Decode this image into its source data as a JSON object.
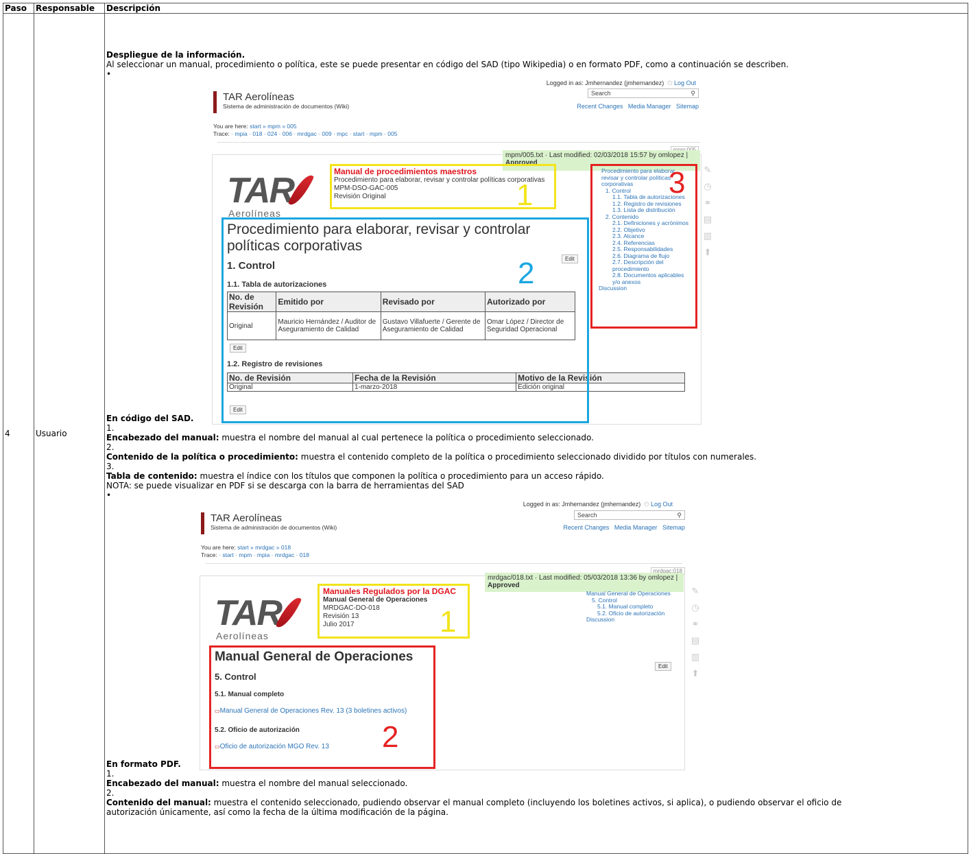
{
  "table": {
    "headers": {
      "paso": "Paso",
      "responsable": "Responsable",
      "descripcion": "Descripción"
    },
    "row": {
      "paso": "4",
      "responsable": "Usuario"
    }
  },
  "desc": {
    "title": "Despliegue de la información.",
    "intro": "Al seleccionar un manual, procedimiento o política, este se puede presentar en código del SAD (tipo Wikipedia) o en formato PDF, como a continuación se describen.",
    "bullet": "•",
    "sec1_caption": "En código del SAD.",
    "sec1_items": [
      {
        "n": "1.",
        "label": "Encabezado del manual:",
        "text": " muestra el nombre del manual al cual pertenece la política o procedimiento seleccionado."
      },
      {
        "n": "2.",
        "label": "Contenido de la política o procedimiento:",
        "text": " muestra el contenido completo de la política o procedimiento seleccionado dividido por títulos con numerales."
      },
      {
        "n": "3.",
        "label": "Tabla de contenido:",
        "text": " muestra el índice con los títulos que componen la política o procedimiento para un acceso rápido."
      }
    ],
    "note": "NOTA: se puede visualizar en PDF si se descarga con la barra de herramientas del SAD",
    "sec2_caption": "En formato PDF.",
    "sec2_items": [
      {
        "n": "1.",
        "label": "Encabezado del manual:",
        "text": " muestra el nombre del manual seleccionado."
      },
      {
        "n": "2.",
        "label": "Contenido del manual:",
        "text": " muestra el contenido seleccionado, pudiendo observar el manual completo (incluyendo los boletines activos, si aplica), o pudiendo observar el oficio de"
      }
    ],
    "last_line": "autorización únicamente, así como la fecha de la última modificación de la página."
  },
  "shot1": {
    "logged": "Logged in as: Jmhernandez (jmhernandez)",
    "logout": "Log Out",
    "site_title": "TAR Aerolíneas",
    "site_sub": "Sistema de administración de documentos (Wiki)",
    "search": "Search",
    "nav": [
      "Recent Changes",
      "Media Manager",
      "Sitemap"
    ],
    "youarehere_label": "You are here:",
    "youarehere": "start » mpm » 005",
    "trace_label": "Trace:",
    "trace": "· mpia · 018 · 024 · 006 · mrdgac · 009 · mpc · start · mpm · 005",
    "pageid": "mpm:005",
    "modified": "mpm/005.txt · Last modified: 02/03/2018 15:57 by omlopez |",
    "approved": "Approved",
    "logo": "TAR",
    "aero": "Aerolíneas",
    "hdr_title": "Manual de procedimientos maestros",
    "hdr_lines": [
      "Procedimiento para elaborar, revisar y controlar políticas corporativas",
      "MPM-DSO-GAC-005",
      "Revisión Original"
    ],
    "h1": "Procedimiento para elaborar, revisar y controlar",
    "h1b": "políticas corporativas",
    "h2": "1. Control",
    "h3a": "1.1. Tabla de autorizaciones",
    "t1_headers": [
      "No. de Revisión",
      "Emitido por",
      "Revisado por",
      "Autorizado por"
    ],
    "t1_row": [
      "Original",
      "Mauricio Hernández / Auditor de Aseguramiento de Calidad",
      "Gustavo Villafuerte / Gerente de Aseguramiento de Calidad",
      "Omar López / Director de Seguridad Operacional"
    ],
    "edit": "Edit",
    "h3b": "1.2. Registro de revisiones",
    "t2_headers": [
      "No. de Revisión",
      "Fecha de la Revisión",
      "Motivo de la Revisión"
    ],
    "t2_row": [
      "Original",
      "1-marzo-2018",
      "Edición original"
    ],
    "toc": [
      "Procedimiento para elaborar",
      "revisar y controlar políticas",
      "corporativas",
      "1. Control",
      "1.1. Tabla de autorizaciones",
      "1.2. Registro de revisiones",
      "1.3. Lista de distribución",
      "2. Contenido",
      "2.1. Definiciones y acrónimos",
      "2.2. Objetivo",
      "2.3. Alcance",
      "2.4. Referencias",
      "2.5. Responsabilidades",
      "2.6. Diagrama de flujo",
      "2.7. Descripción del",
      "procedimiento",
      "2.8. Documentos aplicables",
      "y/o anexos",
      "Discussion"
    ],
    "n1": "1",
    "n2": "2",
    "n3": "3"
  },
  "shot2": {
    "logged": "Logged in as: Jmhernandez (jmhernandez)",
    "logout": "Log Out",
    "site_title": "TAR Aerolíneas",
    "site_sub": "Sistema de administración de documentos (Wiki)",
    "search": "Search",
    "nav": [
      "Recent Changes",
      "Media Manager",
      "Sitemap"
    ],
    "youarehere_label": "You are here:",
    "youarehere": "start » mrdgac » 018",
    "trace_label": "Trace:",
    "trace": "· start · mpm · mpia · mrdgac · 018",
    "pageid": "mrdgac:018",
    "modified": "mrdgac/018.txt · Last modified: 05/03/2018 13:36 by omlopez |",
    "approved": "Approved",
    "logo": "TAR",
    "aero": "Aerolíneas",
    "hdr_title": "Manuales Regulados por la DGAC",
    "hdr_bold": "Manual General de Operaciones",
    "hdr_lines": [
      "MRDGAC-DO-018",
      "Revisión 13",
      "Julio 2017"
    ],
    "h1": "Manual General de Operaciones",
    "h2": "5. Control",
    "h3a": "5.1. Manual completo",
    "link1": "Manual General de Operaciones Rev. 13 (3 boletines activos)",
    "h3b": "5.2. Oficio de autorización",
    "link2": "Oficio de autorización MGO Rev. 13",
    "edit": "Edit",
    "toc": [
      "Manual General de Operaciones",
      "5. Control",
      "5.1. Manual completo",
      "5.2. Oficio de autorización",
      "Discussion"
    ],
    "n1": "1",
    "n2": "2"
  }
}
